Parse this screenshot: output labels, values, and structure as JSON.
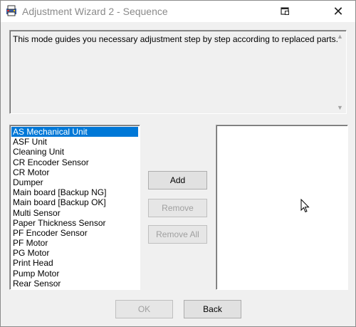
{
  "window": {
    "title": "Adjustment Wizard 2 - Sequence",
    "close_glyph": "✕"
  },
  "description": {
    "text": "This mode guides you necessary adjustment step by step according to replaced parts."
  },
  "parts_list": {
    "items": [
      "AS Mechanical Unit",
      "ASF Unit",
      "Cleaning Unit",
      "CR Encoder Sensor",
      "CR Motor",
      "Dumper",
      "Main board [Backup NG]",
      "Main board [Backup OK]",
      "Multi Sensor",
      "Paper Thickness Sensor",
      "PF Encoder Sensor",
      "PF Motor",
      "PG Motor",
      "Print Head",
      "Pump Motor",
      "Rear Sensor"
    ],
    "selected_index": 0
  },
  "selected_list": {
    "items": []
  },
  "buttons": {
    "add": "Add",
    "remove": "Remove",
    "remove_all": "Remove All",
    "ok": "OK",
    "back": "Back"
  },
  "colors": {
    "selection": "#0078d7",
    "disabled_text": "#a0a0a0"
  }
}
